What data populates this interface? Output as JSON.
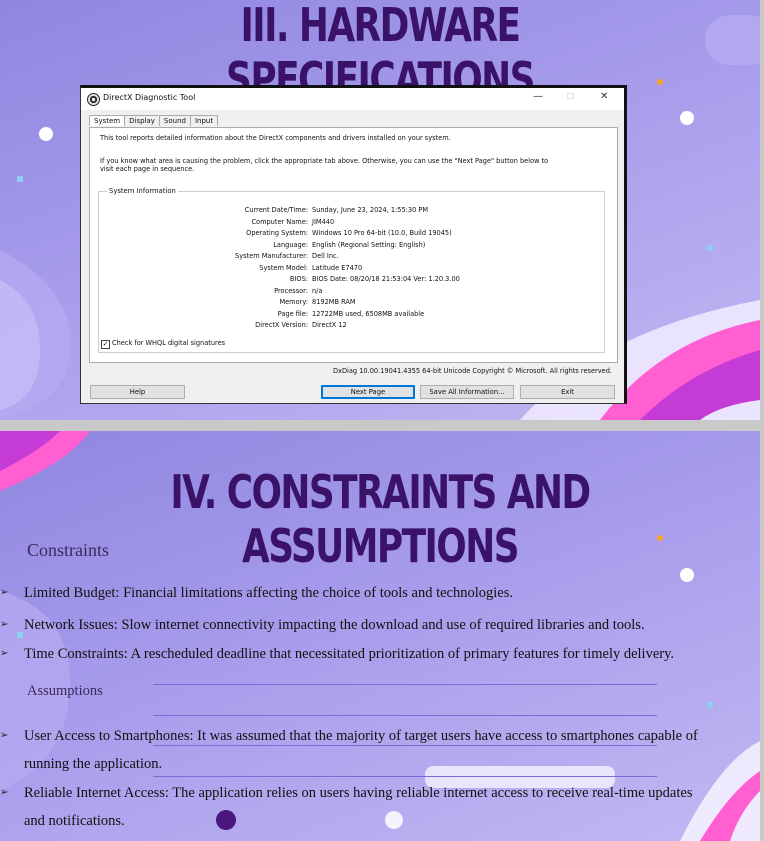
{
  "slide1": {
    "heading": "III. HARDWARE SPECIFICATIONS",
    "dialog": {
      "title": "DirectX Diagnostic Tool",
      "window_controls": {
        "minimize": "—",
        "maximize": "☐",
        "close": "✕"
      },
      "tabs": [
        "System",
        "Display",
        "Sound",
        "Input"
      ],
      "active_tab": "System",
      "intro_line1": "This tool reports detailed information about the DirectX components and drivers installed on your system.",
      "intro_line2": "If you know what area is causing the problem, click the appropriate tab above.  Otherwise, you can use the \"Next Page\" button below to",
      "intro_line3": "visit each page in sequence.",
      "group_title": "System Information",
      "info": [
        {
          "label": "Current Date/Time:",
          "value": "Sunday, June 23, 2024, 1:55:30 PM"
        },
        {
          "label": "Computer Name:",
          "value": "JIM440"
        },
        {
          "label": "Operating System:",
          "value": "Windows 10 Pro 64-bit (10.0, Build 19045)"
        },
        {
          "label": "Language:",
          "value": "English (Regional Setting: English)"
        },
        {
          "label": "System Manufacturer:",
          "value": "Dell Inc."
        },
        {
          "label": "System Model:",
          "value": "Latitude E7470"
        },
        {
          "label": "BIOS:",
          "value": "BIOS Date: 08/20/18 21:53:04 Ver: 1.20.3.00"
        },
        {
          "label": "Processor:",
          "value": "n/a"
        },
        {
          "label": "Memory:",
          "value": "8192MB RAM"
        },
        {
          "label": "Page file:",
          "value": "12722MB used, 6508MB available"
        },
        {
          "label": "DirectX Version:",
          "value": "DirectX 12"
        }
      ],
      "whql_label": "Check for WHQL digital signatures",
      "whql_checked": true,
      "footer": "DxDiag 10.00.19041.4355 64-bit Unicode  Copyright © Microsoft. All rights reserved.",
      "buttons": {
        "help": "Help",
        "next": "Next Page",
        "save": "Save All Information...",
        "exit": "Exit"
      }
    }
  },
  "slide2": {
    "heading": "IV. CONSTRAINTS AND ASSUMPTIONS",
    "constraints_title": "Constraints",
    "constraints": [
      "Limited Budget: Financial limitations affecting the choice of tools and technologies.",
      "Network Issues: Slow internet connectivity impacting the download and use of required libraries and tools.",
      "Time Constraints: A rescheduled deadline that necessitated prioritization of primary features for timely delivery."
    ],
    "assumptions_title": "Assumptions",
    "assumptions": [
      {
        "line1": "User Access to Smartphones: It was assumed that the majority of target users have access to smartphones capable of",
        "line2": "running the application."
      },
      {
        "line1": "Reliable Internet Access: The application relies on users having reliable internet access to receive real-time updates",
        "line2": "and notifications."
      }
    ],
    "bullet_glyph": "➢"
  },
  "colors": {
    "heading": "#3a1268",
    "slide_bg": "#a79ceb",
    "accent_pink": "#ff5fd0",
    "accent_orange": "#f5a623"
  }
}
